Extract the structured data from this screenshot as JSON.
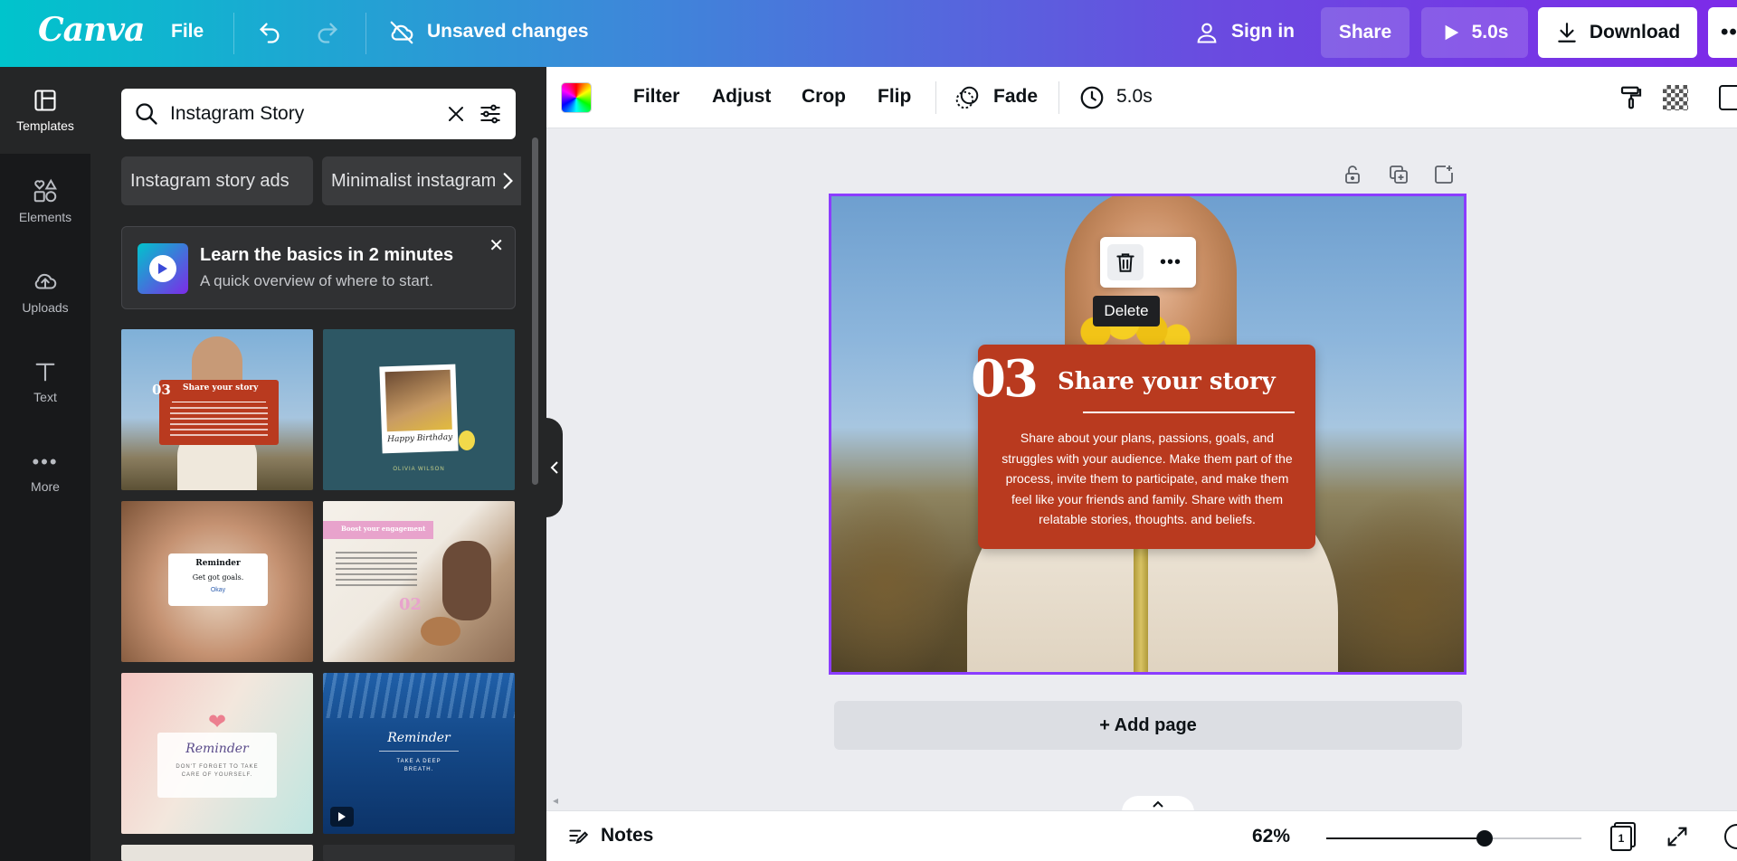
{
  "app": {
    "logo": "Canva"
  },
  "topbar": {
    "file_label": "File",
    "status": "Unsaved changes",
    "sign_in": "Sign in",
    "share": "Share",
    "play_duration": "5.0s",
    "download": "Download"
  },
  "rail": {
    "items": [
      {
        "label": "Templates",
        "icon": "templates-icon"
      },
      {
        "label": "Elements",
        "icon": "elements-icon"
      },
      {
        "label": "Uploads",
        "icon": "uploads-icon"
      },
      {
        "label": "Text",
        "icon": "text-icon"
      },
      {
        "label": "More",
        "icon": "more-icon"
      }
    ]
  },
  "panel": {
    "search_value": "Instagram Story",
    "chips": [
      "Instagram story ads",
      "Minimalist instagram"
    ],
    "learn_title": "Learn the basics in 2 minutes",
    "learn_subtitle": "A quick overview of where to start.",
    "thumbs": {
      "t1_number": "03",
      "t1_title": "Share your story",
      "t2_text": "Happy Birthday",
      "t2_name": "OLIVIA WILSON",
      "t3_title": "Reminder",
      "t3_text": "Get got goals.",
      "t3_button": "Okay",
      "t4_title": "Boost your engagement",
      "t4_number": "02",
      "t5_title": "Reminder",
      "t5_text": "DON'T FORGET TO TAKE CARE OF YOURSELF.",
      "t6_title": "Reminder",
      "t6_text": "TAKE A DEEP BREATH."
    }
  },
  "toolbar": {
    "filter": "Filter",
    "adjust": "Adjust",
    "crop": "Crop",
    "flip": "Flip",
    "fade": "Fade",
    "duration": "5.0s"
  },
  "canvas": {
    "number": "03",
    "title": "Share your story",
    "body": "Share about your plans, passions, goals, and struggles with your audience. Make them part of the process, invite them to participate, and make them feel like your friends and family. Share with them relatable stories, thoughts. and beliefs.",
    "delete_tooltip": "Delete",
    "add_page": "+ Add page"
  },
  "footer": {
    "notes": "Notes",
    "zoom": "62%",
    "zoom_level": 0.62,
    "page_count": "1"
  },
  "colors": {
    "accent": "#8b3dff",
    "story_box": "#b93a1f",
    "panel_bg": "#252627",
    "rail_bg": "#18191b"
  }
}
